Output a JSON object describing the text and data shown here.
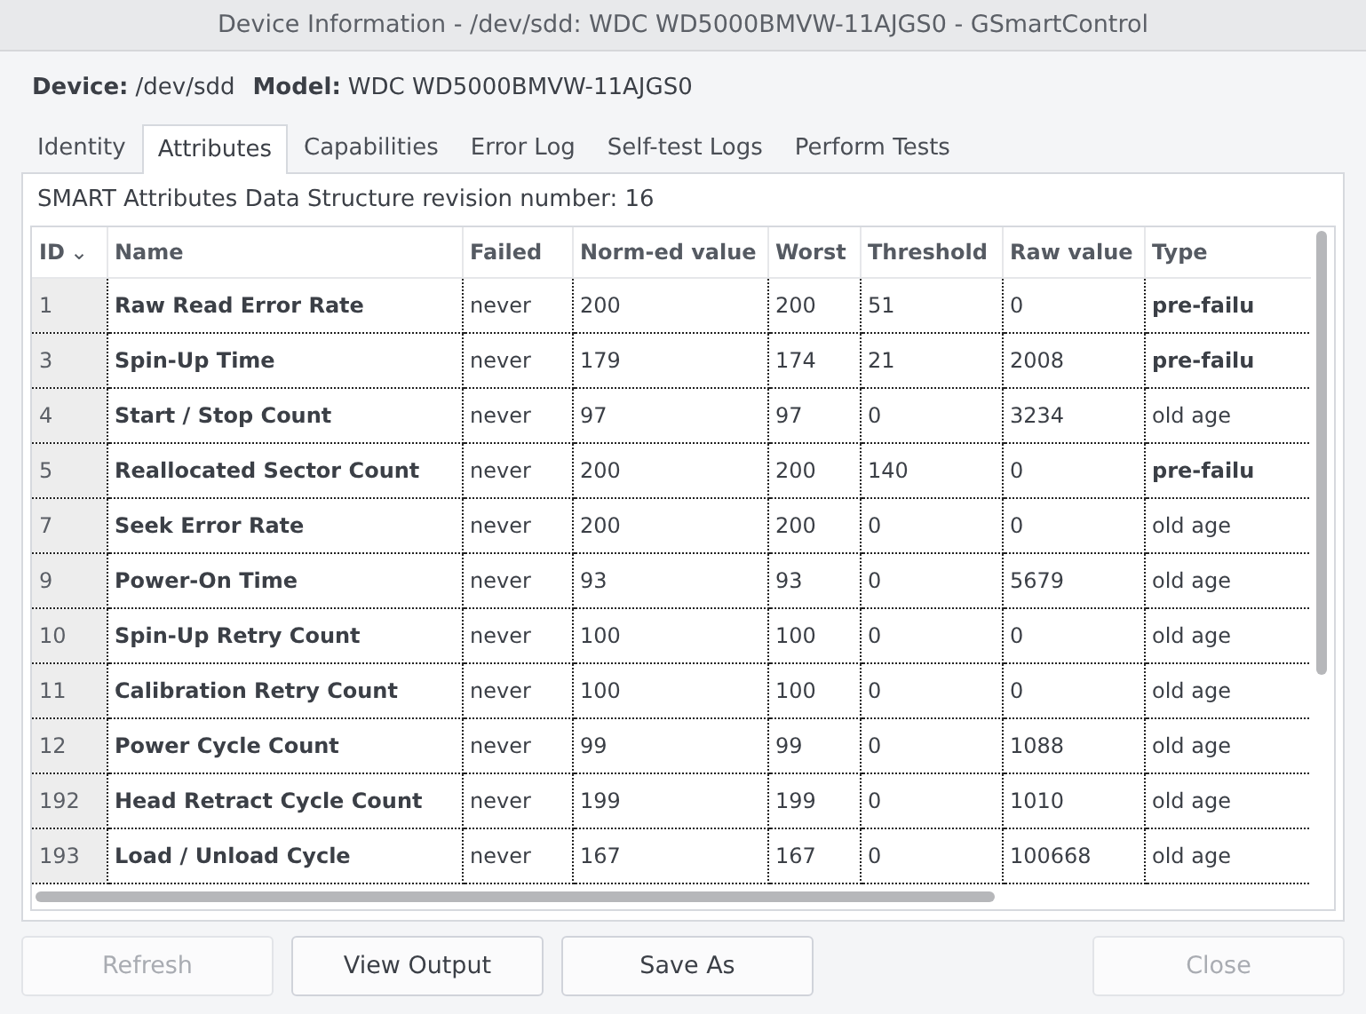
{
  "window": {
    "title": "Device Information - /dev/sdd: WDC WD5000BMVW-11AJGS0 - GSmartControl"
  },
  "device": {
    "device_label": "Device:",
    "device_value": "/dev/sdd",
    "model_label": "Model:",
    "model_value": "WDC WD5000BMVW-11AJGS0"
  },
  "tabs": [
    {
      "label": "Identity",
      "selected": false
    },
    {
      "label": "Attributes",
      "selected": true
    },
    {
      "label": "Capabilities",
      "selected": false
    },
    {
      "label": "Error Log",
      "selected": false
    },
    {
      "label": "Self-test Logs",
      "selected": false
    },
    {
      "label": "Perform Tests",
      "selected": false
    }
  ],
  "revision_text": "SMART Attributes Data Structure revision number: 16",
  "table": {
    "columns": [
      "ID",
      "Name",
      "Failed",
      "Norm-ed value",
      "Worst",
      "Threshold",
      "Raw value",
      "Type"
    ],
    "sort_icon": "⌄",
    "rows": [
      {
        "cells": [
          "1",
          "Raw Read Error Rate",
          "never",
          "200",
          "200",
          "51",
          "0",
          "pre-failu"
        ],
        "prefail": true
      },
      {
        "cells": [
          "3",
          "Spin-Up Time",
          "never",
          "179",
          "174",
          "21",
          "2008",
          "pre-failu"
        ],
        "prefail": true
      },
      {
        "cells": [
          "4",
          "Start / Stop Count",
          "never",
          "97",
          "97",
          "0",
          "3234",
          "old age"
        ],
        "prefail": false
      },
      {
        "cells": [
          "5",
          "Reallocated Sector Count",
          "never",
          "200",
          "200",
          "140",
          "0",
          "pre-failu"
        ],
        "prefail": true
      },
      {
        "cells": [
          "7",
          "Seek Error Rate",
          "never",
          "200",
          "200",
          "0",
          "0",
          "old age"
        ],
        "prefail": false
      },
      {
        "cells": [
          "9",
          "Power-On Time",
          "never",
          "93",
          "93",
          "0",
          "5679",
          "old age"
        ],
        "prefail": false
      },
      {
        "cells": [
          "10",
          "Spin-Up Retry Count",
          "never",
          "100",
          "100",
          "0",
          "0",
          "old age"
        ],
        "prefail": false
      },
      {
        "cells": [
          "11",
          "Calibration Retry Count",
          "never",
          "100",
          "100",
          "0",
          "0",
          "old age"
        ],
        "prefail": false
      },
      {
        "cells": [
          "12",
          "Power Cycle Count",
          "never",
          "99",
          "99",
          "0",
          "1088",
          "old age"
        ],
        "prefail": false
      },
      {
        "cells": [
          "192",
          "Head Retract Cycle Count",
          "never",
          "199",
          "199",
          "0",
          "1010",
          "old age"
        ],
        "prefail": false
      },
      {
        "cells": [
          "193",
          "Load / Unload Cycle",
          "never",
          "167",
          "167",
          "0",
          "100668",
          "old age"
        ],
        "prefail": false
      }
    ]
  },
  "buttons": [
    {
      "label": "Refresh",
      "disabled": true
    },
    {
      "label": "View Output",
      "disabled": false
    },
    {
      "label": "Save As",
      "disabled": false
    },
    {
      "label": "Close",
      "disabled": true
    }
  ]
}
